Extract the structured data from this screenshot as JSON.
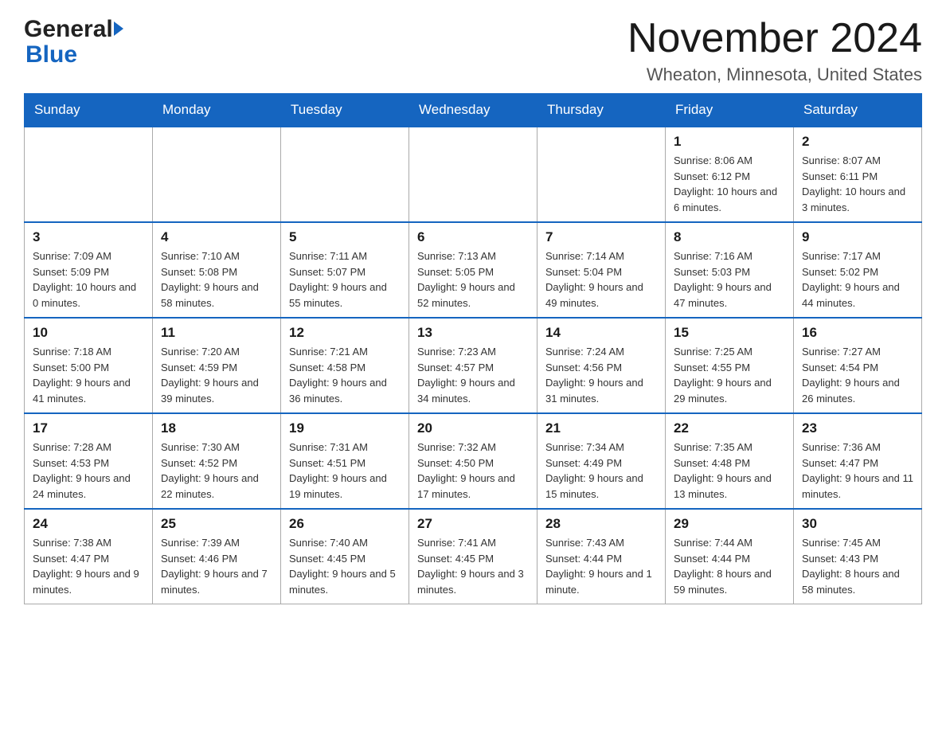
{
  "logo": {
    "general_text": "General",
    "blue_text": "Blue"
  },
  "header": {
    "month_year": "November 2024",
    "location": "Wheaton, Minnesota, United States"
  },
  "weekdays": [
    "Sunday",
    "Monday",
    "Tuesday",
    "Wednesday",
    "Thursday",
    "Friday",
    "Saturday"
  ],
  "weeks": [
    [
      {
        "day": "",
        "info": ""
      },
      {
        "day": "",
        "info": ""
      },
      {
        "day": "",
        "info": ""
      },
      {
        "day": "",
        "info": ""
      },
      {
        "day": "",
        "info": ""
      },
      {
        "day": "1",
        "info": "Sunrise: 8:06 AM\nSunset: 6:12 PM\nDaylight: 10 hours and 6 minutes."
      },
      {
        "day": "2",
        "info": "Sunrise: 8:07 AM\nSunset: 6:11 PM\nDaylight: 10 hours and 3 minutes."
      }
    ],
    [
      {
        "day": "3",
        "info": "Sunrise: 7:09 AM\nSunset: 5:09 PM\nDaylight: 10 hours and 0 minutes."
      },
      {
        "day": "4",
        "info": "Sunrise: 7:10 AM\nSunset: 5:08 PM\nDaylight: 9 hours and 58 minutes."
      },
      {
        "day": "5",
        "info": "Sunrise: 7:11 AM\nSunset: 5:07 PM\nDaylight: 9 hours and 55 minutes."
      },
      {
        "day": "6",
        "info": "Sunrise: 7:13 AM\nSunset: 5:05 PM\nDaylight: 9 hours and 52 minutes."
      },
      {
        "day": "7",
        "info": "Sunrise: 7:14 AM\nSunset: 5:04 PM\nDaylight: 9 hours and 49 minutes."
      },
      {
        "day": "8",
        "info": "Sunrise: 7:16 AM\nSunset: 5:03 PM\nDaylight: 9 hours and 47 minutes."
      },
      {
        "day": "9",
        "info": "Sunrise: 7:17 AM\nSunset: 5:02 PM\nDaylight: 9 hours and 44 minutes."
      }
    ],
    [
      {
        "day": "10",
        "info": "Sunrise: 7:18 AM\nSunset: 5:00 PM\nDaylight: 9 hours and 41 minutes."
      },
      {
        "day": "11",
        "info": "Sunrise: 7:20 AM\nSunset: 4:59 PM\nDaylight: 9 hours and 39 minutes."
      },
      {
        "day": "12",
        "info": "Sunrise: 7:21 AM\nSunset: 4:58 PM\nDaylight: 9 hours and 36 minutes."
      },
      {
        "day": "13",
        "info": "Sunrise: 7:23 AM\nSunset: 4:57 PM\nDaylight: 9 hours and 34 minutes."
      },
      {
        "day": "14",
        "info": "Sunrise: 7:24 AM\nSunset: 4:56 PM\nDaylight: 9 hours and 31 minutes."
      },
      {
        "day": "15",
        "info": "Sunrise: 7:25 AM\nSunset: 4:55 PM\nDaylight: 9 hours and 29 minutes."
      },
      {
        "day": "16",
        "info": "Sunrise: 7:27 AM\nSunset: 4:54 PM\nDaylight: 9 hours and 26 minutes."
      }
    ],
    [
      {
        "day": "17",
        "info": "Sunrise: 7:28 AM\nSunset: 4:53 PM\nDaylight: 9 hours and 24 minutes."
      },
      {
        "day": "18",
        "info": "Sunrise: 7:30 AM\nSunset: 4:52 PM\nDaylight: 9 hours and 22 minutes."
      },
      {
        "day": "19",
        "info": "Sunrise: 7:31 AM\nSunset: 4:51 PM\nDaylight: 9 hours and 19 minutes."
      },
      {
        "day": "20",
        "info": "Sunrise: 7:32 AM\nSunset: 4:50 PM\nDaylight: 9 hours and 17 minutes."
      },
      {
        "day": "21",
        "info": "Sunrise: 7:34 AM\nSunset: 4:49 PM\nDaylight: 9 hours and 15 minutes."
      },
      {
        "day": "22",
        "info": "Sunrise: 7:35 AM\nSunset: 4:48 PM\nDaylight: 9 hours and 13 minutes."
      },
      {
        "day": "23",
        "info": "Sunrise: 7:36 AM\nSunset: 4:47 PM\nDaylight: 9 hours and 11 minutes."
      }
    ],
    [
      {
        "day": "24",
        "info": "Sunrise: 7:38 AM\nSunset: 4:47 PM\nDaylight: 9 hours and 9 minutes."
      },
      {
        "day": "25",
        "info": "Sunrise: 7:39 AM\nSunset: 4:46 PM\nDaylight: 9 hours and 7 minutes."
      },
      {
        "day": "26",
        "info": "Sunrise: 7:40 AM\nSunset: 4:45 PM\nDaylight: 9 hours and 5 minutes."
      },
      {
        "day": "27",
        "info": "Sunrise: 7:41 AM\nSunset: 4:45 PM\nDaylight: 9 hours and 3 minutes."
      },
      {
        "day": "28",
        "info": "Sunrise: 7:43 AM\nSunset: 4:44 PM\nDaylight: 9 hours and 1 minute."
      },
      {
        "day": "29",
        "info": "Sunrise: 7:44 AM\nSunset: 4:44 PM\nDaylight: 8 hours and 59 minutes."
      },
      {
        "day": "30",
        "info": "Sunrise: 7:45 AM\nSunset: 4:43 PM\nDaylight: 8 hours and 58 minutes."
      }
    ]
  ]
}
